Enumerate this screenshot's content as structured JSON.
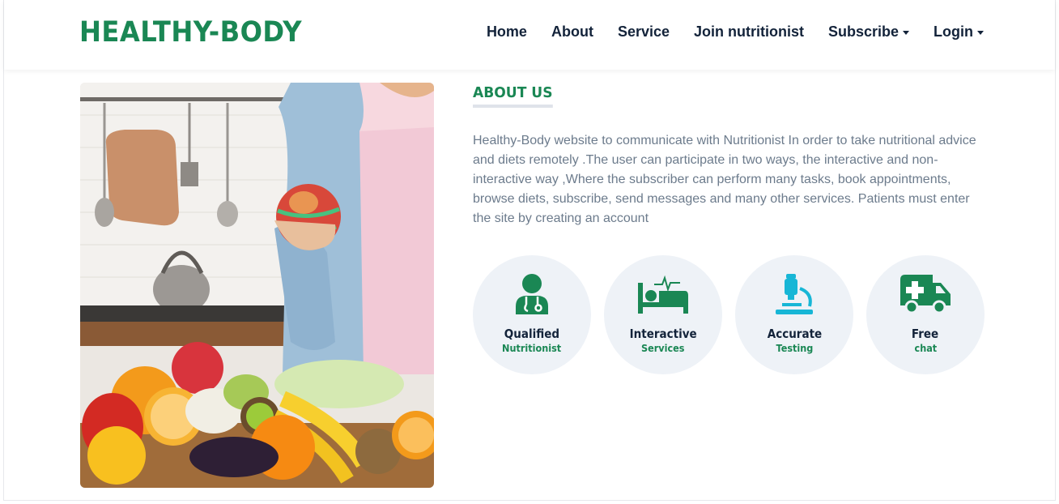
{
  "brand": {
    "name": "HEALTHY-BODY",
    "color": "#1a8754"
  },
  "nav": {
    "items": [
      {
        "label": "Home",
        "dropdown": false
      },
      {
        "label": "About",
        "dropdown": false
      },
      {
        "label": "Service",
        "dropdown": false
      },
      {
        "label": "Join nutritionist",
        "dropdown": false
      },
      {
        "label": "Subscribe",
        "dropdown": true
      },
      {
        "label": "Login",
        "dropdown": true
      }
    ]
  },
  "about": {
    "title": "ABOUT US",
    "text": "Healthy-Body website to communicate with Nutritionist In order to take nutritional advice and diets remotely .The user can participate in two ways, the interactive and non-interactive way ,Where the subscriber can perform many tasks, book appointments, browse diets, subscribe, send messages and many other services. Patients must enter the site by creating an account",
    "image_icon": "woman-holding-apple-with-vegetables-photo"
  },
  "features": [
    {
      "icon": "doctor-icon",
      "title": "Qualified",
      "subtitle": "Nutritionist",
      "icon_color": "#1a8754"
    },
    {
      "icon": "hospital-bed-icon",
      "title": "Interactive",
      "subtitle": "Services",
      "icon_color": "#1a8754"
    },
    {
      "icon": "microscope-icon",
      "title": "Accurate",
      "subtitle": "Testing",
      "icon_color": "#17b6d6"
    },
    {
      "icon": "ambulance-icon",
      "title": "Free",
      "subtitle": "chat",
      "icon_color": "#1a8754"
    }
  ]
}
